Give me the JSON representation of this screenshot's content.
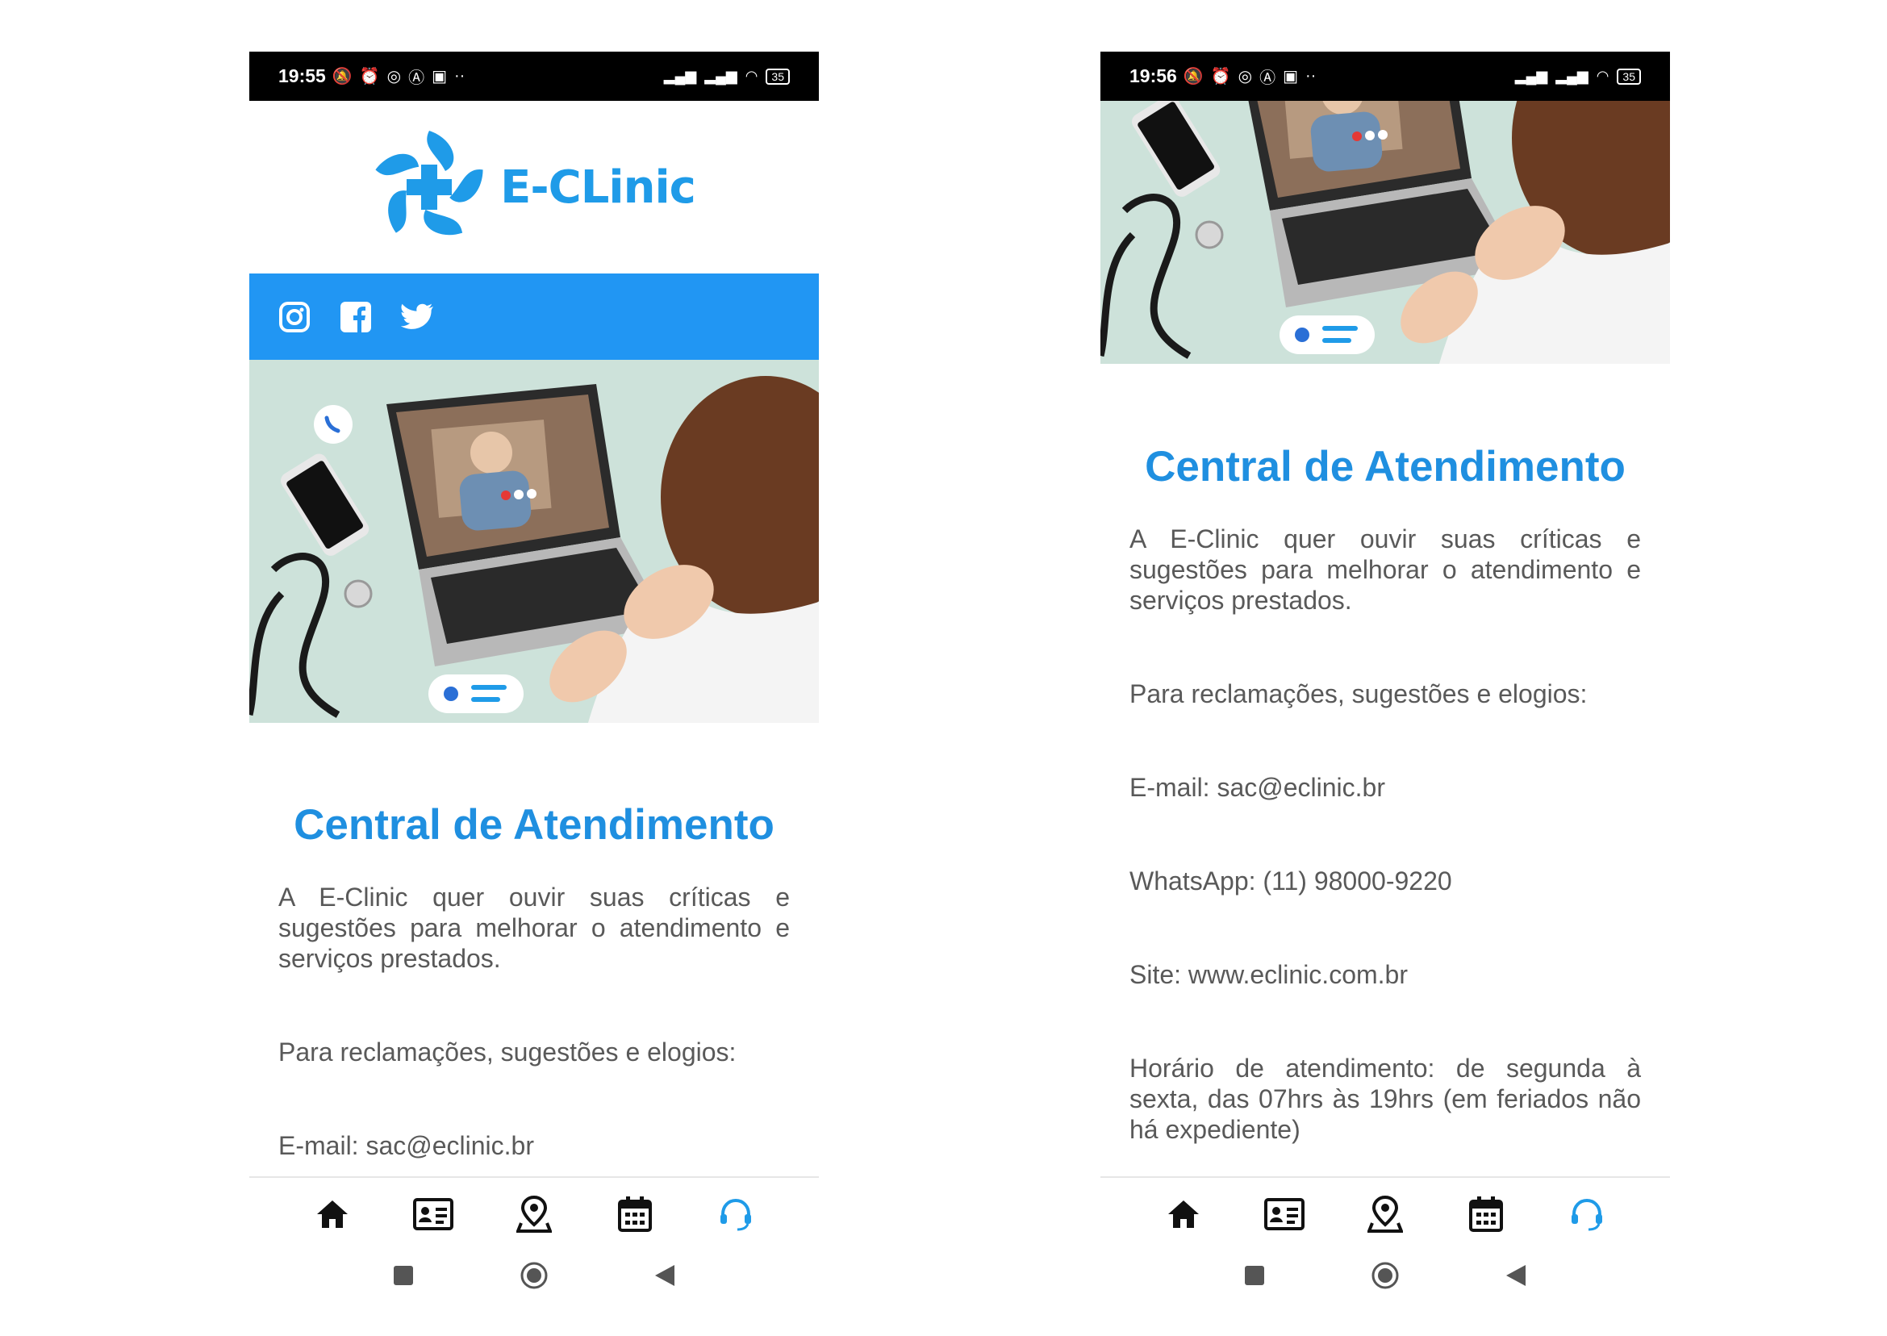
{
  "colors": {
    "brand_blue": "#2196f3",
    "title_blue": "#1f8fe0",
    "active_nav": "#1f9be8",
    "text_gray": "#595959"
  },
  "left": {
    "status": {
      "time": "19:55",
      "battery": "35"
    },
    "brand": {
      "name": "E-CLinic"
    },
    "social_icons": [
      "instagram-icon",
      "facebook-icon",
      "twitter-icon"
    ],
    "title": "Central de Atendimento",
    "intro": "A E-Clinic quer ouvir suas críticas e sugestões para melhorar o atendimento e serviços prestados.",
    "contact_heading": "Para reclamações, sugestões e elogios:",
    "email": "E-mail: sac@eclinic.br"
  },
  "right": {
    "status": {
      "time": "19:56",
      "battery": "35"
    },
    "title": "Central de Atendimento",
    "intro": "A E-Clinic quer ouvir suas críticas e sugestões para melhorar o atendimento e serviços prestados.",
    "contact_heading": "Para reclamações, sugestões e elogios:",
    "email": "E-mail: sac@eclinic.br",
    "whatsapp": "WhatsApp: (11) 98000-9220",
    "site": "Site: www.eclinic.com.br",
    "hours": "Horário de atendimento: de segunda à sexta, das 07hrs às 19hrs (em feriados não há expediente)"
  },
  "bottom_nav": [
    {
      "icon": "home-icon",
      "active": false
    },
    {
      "icon": "id-card-icon",
      "active": false
    },
    {
      "icon": "map-pin-icon",
      "active": false
    },
    {
      "icon": "calendar-icon",
      "active": false
    },
    {
      "icon": "headset-icon",
      "active": true
    }
  ],
  "system_nav": [
    "recents-icon",
    "home-circle-icon",
    "back-icon"
  ]
}
